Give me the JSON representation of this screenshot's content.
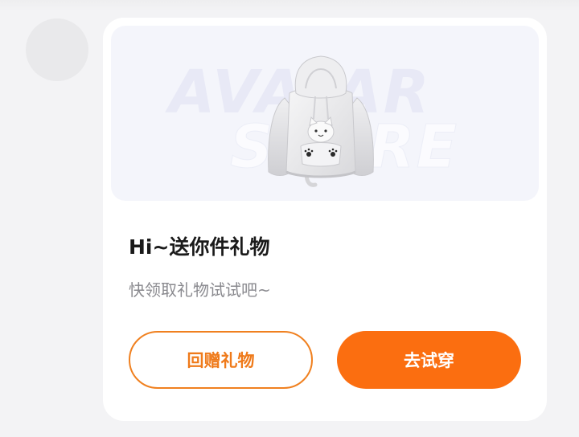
{
  "avatar": {
    "icon": "avatar-placeholder"
  },
  "banner": {
    "watermark_line1": "AVATAR",
    "watermark_line2": "STORE",
    "image": "white-cat-hoodie"
  },
  "message": {
    "title": "Hi~送你件礼物",
    "subtitle": "快领取礼物试试吧~"
  },
  "actions": {
    "return_gift_label": "回赠礼物",
    "try_on_label": "去试穿"
  },
  "colors": {
    "accent": "#fb6e10",
    "accent_outline": "#f0801f",
    "card_bg": "#ffffff",
    "page_bg": "#f3f3f5"
  }
}
